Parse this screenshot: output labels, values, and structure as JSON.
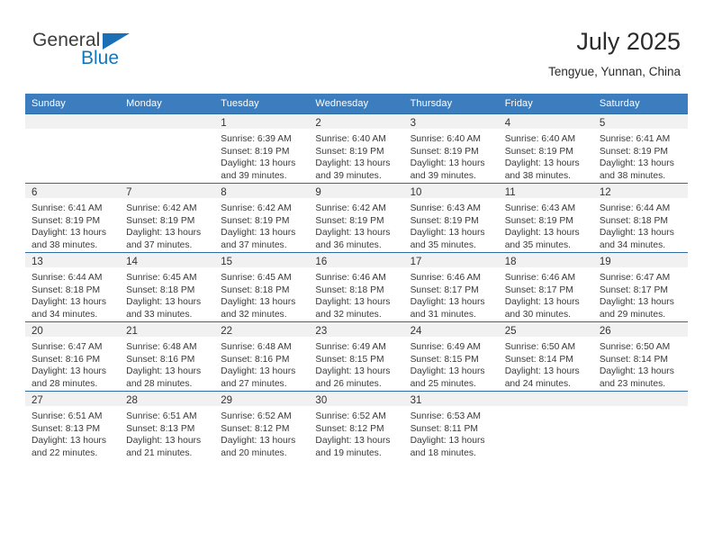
{
  "logo": {
    "word1": "General",
    "word2": "Blue",
    "triangle_color": "#1a6fb5",
    "blue_color": "#1278be"
  },
  "header": {
    "title": "July 2025",
    "subtitle": "Tengyue, Yunnan, China"
  },
  "theme": {
    "header_bg": "#3b7dbf",
    "row_divider": "#2e6da4",
    "daynum_bg": "#f1f1f1"
  },
  "weekdays": [
    "Sunday",
    "Monday",
    "Tuesday",
    "Wednesday",
    "Thursday",
    "Friday",
    "Saturday"
  ],
  "labels": {
    "sunrise_prefix": "Sunrise:",
    "sunset_prefix": "Sunset:",
    "daylight_prefix": "Daylight:"
  },
  "weeks": [
    [
      {
        "day": "",
        "empty": true
      },
      {
        "day": "",
        "empty": true
      },
      {
        "day": "1",
        "sunrise": "Sunrise: 6:39 AM",
        "sunset": "Sunset: 8:19 PM",
        "daylight1": "Daylight: 13 hours",
        "daylight2": "and 39 minutes."
      },
      {
        "day": "2",
        "sunrise": "Sunrise: 6:40 AM",
        "sunset": "Sunset: 8:19 PM",
        "daylight1": "Daylight: 13 hours",
        "daylight2": "and 39 minutes."
      },
      {
        "day": "3",
        "sunrise": "Sunrise: 6:40 AM",
        "sunset": "Sunset: 8:19 PM",
        "daylight1": "Daylight: 13 hours",
        "daylight2": "and 39 minutes."
      },
      {
        "day": "4",
        "sunrise": "Sunrise: 6:40 AM",
        "sunset": "Sunset: 8:19 PM",
        "daylight1": "Daylight: 13 hours",
        "daylight2": "and 38 minutes."
      },
      {
        "day": "5",
        "sunrise": "Sunrise: 6:41 AM",
        "sunset": "Sunset: 8:19 PM",
        "daylight1": "Daylight: 13 hours",
        "daylight2": "and 38 minutes."
      }
    ],
    [
      {
        "day": "6",
        "sunrise": "Sunrise: 6:41 AM",
        "sunset": "Sunset: 8:19 PM",
        "daylight1": "Daylight: 13 hours",
        "daylight2": "and 38 minutes."
      },
      {
        "day": "7",
        "sunrise": "Sunrise: 6:42 AM",
        "sunset": "Sunset: 8:19 PM",
        "daylight1": "Daylight: 13 hours",
        "daylight2": "and 37 minutes."
      },
      {
        "day": "8",
        "sunrise": "Sunrise: 6:42 AM",
        "sunset": "Sunset: 8:19 PM",
        "daylight1": "Daylight: 13 hours",
        "daylight2": "and 37 minutes."
      },
      {
        "day": "9",
        "sunrise": "Sunrise: 6:42 AM",
        "sunset": "Sunset: 8:19 PM",
        "daylight1": "Daylight: 13 hours",
        "daylight2": "and 36 minutes."
      },
      {
        "day": "10",
        "sunrise": "Sunrise: 6:43 AM",
        "sunset": "Sunset: 8:19 PM",
        "daylight1": "Daylight: 13 hours",
        "daylight2": "and 35 minutes."
      },
      {
        "day": "11",
        "sunrise": "Sunrise: 6:43 AM",
        "sunset": "Sunset: 8:19 PM",
        "daylight1": "Daylight: 13 hours",
        "daylight2": "and 35 minutes."
      },
      {
        "day": "12",
        "sunrise": "Sunrise: 6:44 AM",
        "sunset": "Sunset: 8:18 PM",
        "daylight1": "Daylight: 13 hours",
        "daylight2": "and 34 minutes."
      }
    ],
    [
      {
        "day": "13",
        "sunrise": "Sunrise: 6:44 AM",
        "sunset": "Sunset: 8:18 PM",
        "daylight1": "Daylight: 13 hours",
        "daylight2": "and 34 minutes."
      },
      {
        "day": "14",
        "sunrise": "Sunrise: 6:45 AM",
        "sunset": "Sunset: 8:18 PM",
        "daylight1": "Daylight: 13 hours",
        "daylight2": "and 33 minutes."
      },
      {
        "day": "15",
        "sunrise": "Sunrise: 6:45 AM",
        "sunset": "Sunset: 8:18 PM",
        "daylight1": "Daylight: 13 hours",
        "daylight2": "and 32 minutes."
      },
      {
        "day": "16",
        "sunrise": "Sunrise: 6:46 AM",
        "sunset": "Sunset: 8:18 PM",
        "daylight1": "Daylight: 13 hours",
        "daylight2": "and 32 minutes."
      },
      {
        "day": "17",
        "sunrise": "Sunrise: 6:46 AM",
        "sunset": "Sunset: 8:17 PM",
        "daylight1": "Daylight: 13 hours",
        "daylight2": "and 31 minutes."
      },
      {
        "day": "18",
        "sunrise": "Sunrise: 6:46 AM",
        "sunset": "Sunset: 8:17 PM",
        "daylight1": "Daylight: 13 hours",
        "daylight2": "and 30 minutes."
      },
      {
        "day": "19",
        "sunrise": "Sunrise: 6:47 AM",
        "sunset": "Sunset: 8:17 PM",
        "daylight1": "Daylight: 13 hours",
        "daylight2": "and 29 minutes."
      }
    ],
    [
      {
        "day": "20",
        "sunrise": "Sunrise: 6:47 AM",
        "sunset": "Sunset: 8:16 PM",
        "daylight1": "Daylight: 13 hours",
        "daylight2": "and 28 minutes."
      },
      {
        "day": "21",
        "sunrise": "Sunrise: 6:48 AM",
        "sunset": "Sunset: 8:16 PM",
        "daylight1": "Daylight: 13 hours",
        "daylight2": "and 28 minutes."
      },
      {
        "day": "22",
        "sunrise": "Sunrise: 6:48 AM",
        "sunset": "Sunset: 8:16 PM",
        "daylight1": "Daylight: 13 hours",
        "daylight2": "and 27 minutes."
      },
      {
        "day": "23",
        "sunrise": "Sunrise: 6:49 AM",
        "sunset": "Sunset: 8:15 PM",
        "daylight1": "Daylight: 13 hours",
        "daylight2": "and 26 minutes."
      },
      {
        "day": "24",
        "sunrise": "Sunrise: 6:49 AM",
        "sunset": "Sunset: 8:15 PM",
        "daylight1": "Daylight: 13 hours",
        "daylight2": "and 25 minutes."
      },
      {
        "day": "25",
        "sunrise": "Sunrise: 6:50 AM",
        "sunset": "Sunset: 8:14 PM",
        "daylight1": "Daylight: 13 hours",
        "daylight2": "and 24 minutes."
      },
      {
        "day": "26",
        "sunrise": "Sunrise: 6:50 AM",
        "sunset": "Sunset: 8:14 PM",
        "daylight1": "Daylight: 13 hours",
        "daylight2": "and 23 minutes."
      }
    ],
    [
      {
        "day": "27",
        "sunrise": "Sunrise: 6:51 AM",
        "sunset": "Sunset: 8:13 PM",
        "daylight1": "Daylight: 13 hours",
        "daylight2": "and 22 minutes."
      },
      {
        "day": "28",
        "sunrise": "Sunrise: 6:51 AM",
        "sunset": "Sunset: 8:13 PM",
        "daylight1": "Daylight: 13 hours",
        "daylight2": "and 21 minutes."
      },
      {
        "day": "29",
        "sunrise": "Sunrise: 6:52 AM",
        "sunset": "Sunset: 8:12 PM",
        "daylight1": "Daylight: 13 hours",
        "daylight2": "and 20 minutes."
      },
      {
        "day": "30",
        "sunrise": "Sunrise: 6:52 AM",
        "sunset": "Sunset: 8:12 PM",
        "daylight1": "Daylight: 13 hours",
        "daylight2": "and 19 minutes."
      },
      {
        "day": "31",
        "sunrise": "Sunrise: 6:53 AM",
        "sunset": "Sunset: 8:11 PM",
        "daylight1": "Daylight: 13 hours",
        "daylight2": "and 18 minutes."
      },
      {
        "day": "",
        "empty": true
      },
      {
        "day": "",
        "empty": true
      }
    ]
  ]
}
